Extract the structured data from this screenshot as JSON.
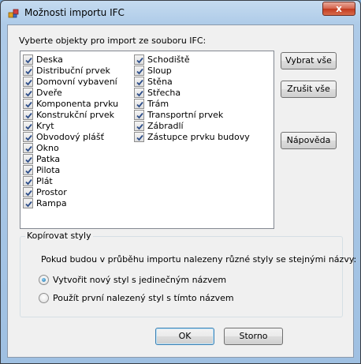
{
  "window": {
    "title": "Možnosti importu IFC",
    "close_glyph": "x"
  },
  "intro_label": "Vyberte objekty pro import ze souboru IFC:",
  "objects_col1": [
    "Deska",
    "Distribuční prvek",
    "Domovní vybavení",
    "Dveře",
    "Komponenta prvku",
    "Konstrukční prvek",
    "Kryt",
    "Obvodový plášť",
    "Okno",
    "Patka",
    "Pilota",
    "Plát",
    "Prostor",
    "Rampa"
  ],
  "objects_col2": [
    "Schodiště",
    "Sloup",
    "Stěna",
    "Střecha",
    "Trám",
    "Transportní prvek",
    "Zábradlí",
    "Zástupce prvku budovy"
  ],
  "buttons": {
    "select_all": "Vybrat vše",
    "clear_all": "Zrušit vše",
    "help": "Nápověda",
    "ok": "OK",
    "cancel": "Storno"
  },
  "copy_styles": {
    "legend": "Kopírovat styly",
    "description": "Pokud budou v průběhu importu nalezeny různé styly se stejnými názvy:",
    "options": [
      "Vytvořit nový styl s jedinečným názvem",
      "Použít první nalezený styl s tímto názvem"
    ],
    "selected_index": 0
  },
  "colors": {
    "check": "#2d4e8a",
    "title_bar": "#aecbe8",
    "dialog_bg": "#f0f0f0"
  }
}
